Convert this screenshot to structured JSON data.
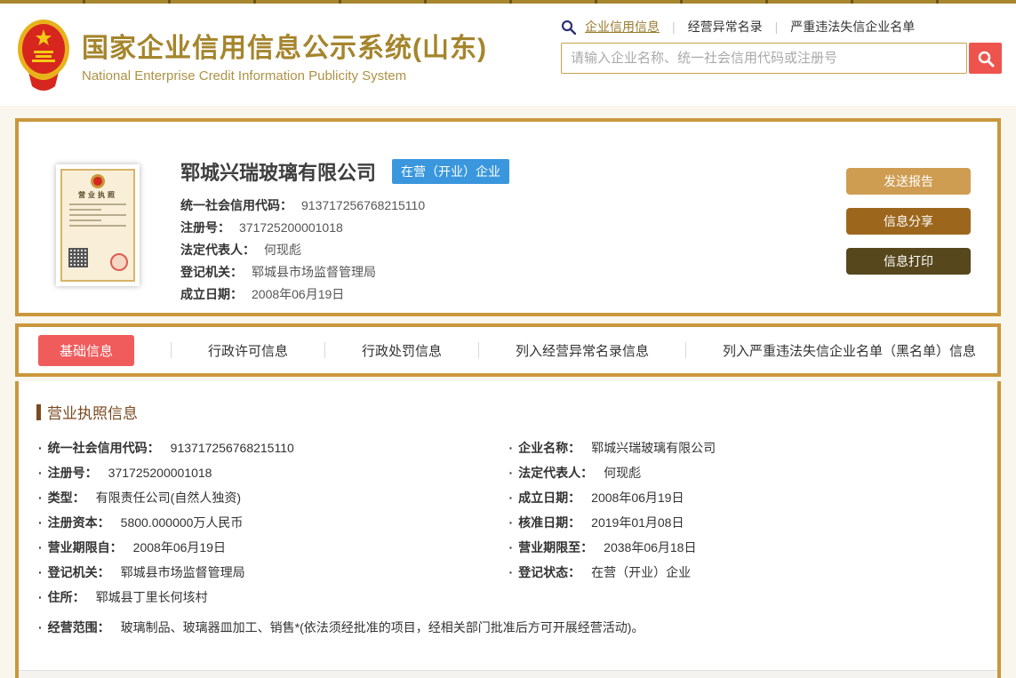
{
  "colors": {
    "gold_border": "#c9973c",
    "title_gold": "#a5852c",
    "tab_active_red": "#f05b5b",
    "search_button_red": "#ee544e",
    "badge_blue": "#3a97dd",
    "btn_send": "#cf9d52",
    "btn_share": "#9c671d",
    "btn_print": "#57471d",
    "section_brown": "#7b4a21"
  },
  "header": {
    "title": "国家企业信用信息公示系统(山东)",
    "subtitle": "National Enterprise Credit Information Publicity System",
    "nav": [
      {
        "label": "企业信用信息",
        "active": true
      },
      {
        "label": "经营异常名录",
        "active": false
      },
      {
        "label": "严重违法失信企业名单",
        "active": false
      }
    ],
    "search": {
      "placeholder": "请输入企业名称、统一社会信用代码或注册号"
    }
  },
  "company": {
    "name": "郓城兴瑞玻璃有限公司",
    "status_badge": "在营（开业）企业",
    "summary": [
      {
        "label": "统一社会信用代码：",
        "value": "913717256768215110"
      },
      {
        "label": "注册号：",
        "value": "371725200001018"
      },
      {
        "label": "法定代表人：",
        "value": "何现彪"
      },
      {
        "label": "登记机关：",
        "value": "郓城县市场监督管理局"
      },
      {
        "label": "成立日期：",
        "value": "2008年06月19日"
      }
    ],
    "actions": {
      "send_report": "发送报告",
      "share_info": "信息分享",
      "print_info": "信息打印"
    }
  },
  "tabs": [
    {
      "label": "基础信息",
      "active": true
    },
    {
      "label": "行政许可信息",
      "active": false
    },
    {
      "label": "行政处罚信息",
      "active": false
    },
    {
      "label": "列入经营异常名录信息",
      "active": false
    },
    {
      "label": "列入严重违法失信企业名单（黑名单）信息",
      "active": false
    }
  ],
  "license_thumb": {
    "title": "营业执照"
  },
  "license_section": {
    "title": "营业执照信息",
    "fields": [
      {
        "label": "统一社会信用代码：",
        "value": "913717256768215110"
      },
      {
        "label": "企业名称：",
        "value": "郓城兴瑞玻璃有限公司"
      },
      {
        "label": "注册号：",
        "value": "371725200001018"
      },
      {
        "label": "法定代表人：",
        "value": "何现彪"
      },
      {
        "label": "类型：",
        "value": "有限责任公司(自然人独资)"
      },
      {
        "label": "成立日期：",
        "value": "2008年06月19日"
      },
      {
        "label": "注册资本：",
        "value": "5800.000000万人民币"
      },
      {
        "label": "核准日期：",
        "value": "2019年01月08日"
      },
      {
        "label": "营业期限自：",
        "value": "2008年06月19日"
      },
      {
        "label": "营业期限至：",
        "value": "2038年06月18日"
      },
      {
        "label": "登记机关：",
        "value": "郓城县市场监督管理局"
      },
      {
        "label": "登记状态：",
        "value": "在营（开业）企业"
      },
      {
        "label": "住所：",
        "value": "郓城县丁里长何垓村"
      },
      {
        "label": "经营范围：",
        "value": "玻璃制品、玻璃器皿加工、销售*(依法须经批准的项目，经相关部门批准后方可开展经营活动)。"
      }
    ]
  }
}
